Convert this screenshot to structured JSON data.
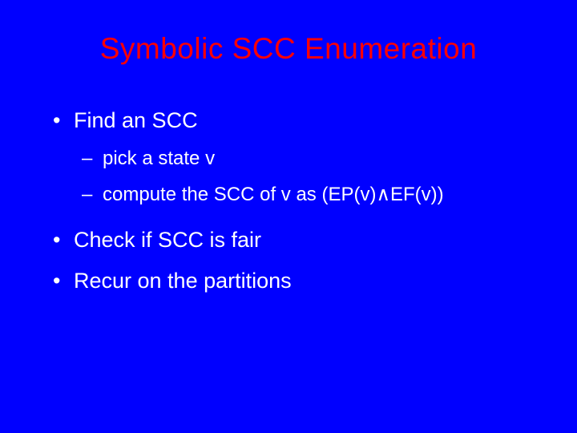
{
  "title": "Symbolic SCC Enumeration",
  "bullets": [
    {
      "level": 1,
      "text": "Find an SCC"
    },
    {
      "level": 2,
      "text": "pick a state v"
    },
    {
      "level": 2,
      "text": "compute the SCC of v as (EP(v)∧EF(v))"
    },
    {
      "level": 1,
      "text": "Check if SCC is fair"
    },
    {
      "level": 1,
      "text": "Recur on the partitions"
    }
  ]
}
